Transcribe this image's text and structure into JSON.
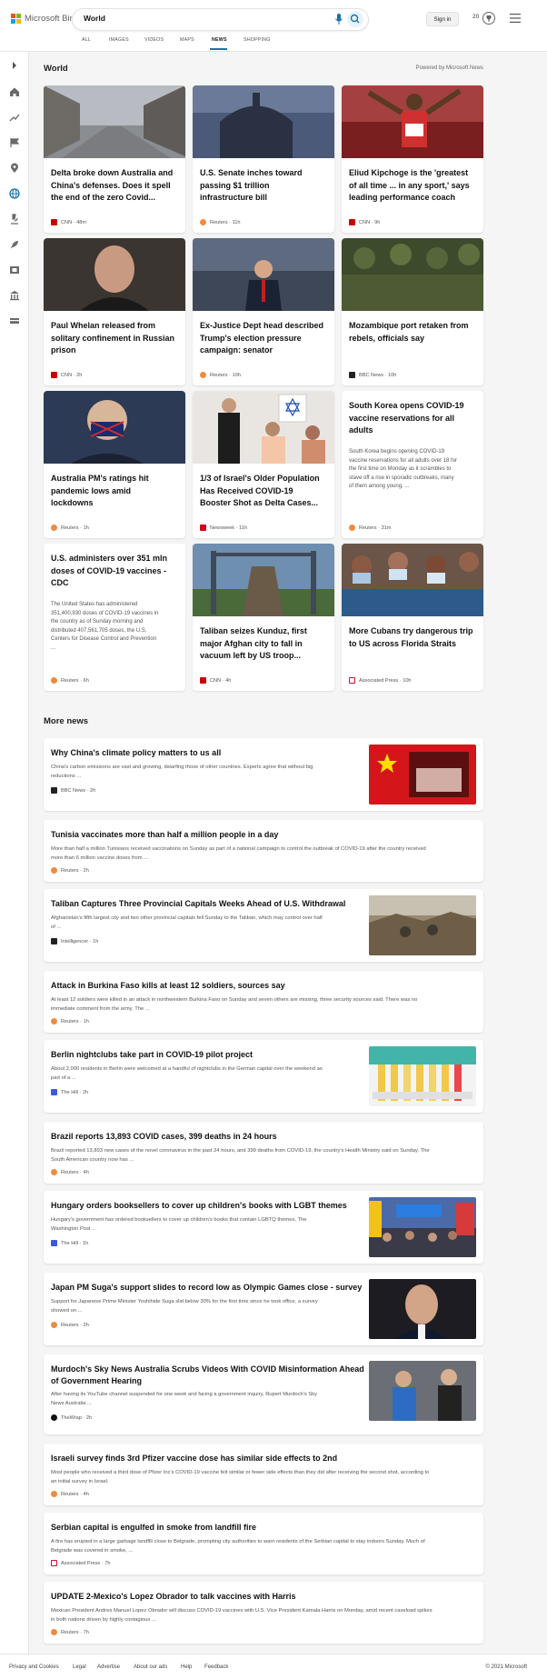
{
  "header": {
    "logo_text": "Microsoft Bing",
    "logo_colors": [
      "#f25022",
      "#7fba00",
      "#00a4ef",
      "#ffb900"
    ],
    "search_value": "World",
    "signin_label": "Sign in",
    "rewards_count": "20",
    "accent": "#1a73a8"
  },
  "tabs": [
    {
      "label": "ALL",
      "active": false
    },
    {
      "label": "IMAGES",
      "active": false
    },
    {
      "label": "VIDEOS",
      "active": false
    },
    {
      "label": "MAPS",
      "active": false
    },
    {
      "label": "NEWS",
      "active": true
    },
    {
      "label": "SHOPPING",
      "active": false
    }
  ],
  "rail": {
    "icons": [
      "chevron-right-icon",
      "home-icon",
      "trending-icon",
      "flag-icon",
      "location-pin-icon",
      "globe-icon",
      "microscope-icon",
      "rocket-icon",
      "film-icon",
      "building-icon",
      "money-icon"
    ],
    "active_color": "#1a73a8"
  },
  "world": {
    "title": "World",
    "powered": "Powered by Microsoft News",
    "cards": [
      {
        "title_lines": [
          "Delta broke down Australia and",
          "China's defenses. Does it spell",
          "the end of the zero Covid..."
        ],
        "source": "CNN",
        "time": "48m",
        "source_icon": "cnn-icon",
        "icon_color": "#cc0000",
        "thumb": "street-icon"
      },
      {
        "title_lines": [
          "U.S. Senate inches toward",
          "passing $1 trillion",
          "infrastructure bill"
        ],
        "source": "Reuters",
        "time": "11h",
        "source_icon": "reuters-icon",
        "icon_color": "#f08b3e",
        "thumb": "capitol-icon"
      },
      {
        "title_lines": [
          "Eliud Kipchoge is the 'greatest",
          "of all time ... in any sport,' says",
          "leading performance coach"
        ],
        "source": "CNN",
        "time": "9h",
        "source_icon": "cnn-icon",
        "icon_color": "#cc0000",
        "thumb": "runner-icon"
      },
      {
        "title_lines": [
          "Paul Whelan released from",
          "solitary confinement in Russian",
          "prison"
        ],
        "source": "CNN",
        "time": "2h",
        "source_icon": "cnn-icon",
        "icon_color": "#cc0000",
        "thumb": "portrait-icon"
      },
      {
        "title_lines": [
          "Ex-Justice Dept head described",
          "Trump's election pressure",
          "campaign: senator"
        ],
        "source": "Reuters",
        "time": "10h",
        "source_icon": "reuters-icon",
        "icon_color": "#f08b3e",
        "thumb": "speaker-icon"
      },
      {
        "title_lines": [
          "Mozambique port retaken from",
          "rebels, officials say"
        ],
        "source": "BBC News",
        "time": "10h",
        "source_icon": "bbc-icon",
        "icon_color": "#222222",
        "thumb": "soldiers-icon"
      },
      {
        "title_lines": [
          "Australia PM's ratings hit",
          "pandemic lows amid",
          "lockdowns"
        ],
        "source": "Reuters",
        "time": "1h",
        "source_icon": "reuters-icon",
        "icon_color": "#f08b3e",
        "thumb": "mask-icon"
      },
      {
        "title_lines": [
          "1/3 of Israel's Older Population",
          "Has Received COVID-19",
          "Booster Shot as Delta Cases..."
        ],
        "source": "Newsweek",
        "time": "11h",
        "source_icon": "newsweek-icon",
        "icon_color": "#d0021b",
        "thumb": "vaccine-icon"
      },
      {
        "title_lines": [
          "South Korea opens COVID-19",
          "vaccine reservations for all",
          "adults"
        ],
        "snippet_lines": [
          "South Korea begins opening COVID-19",
          "vaccine reservations for all adults over 18 for",
          "the first time on Monday as it scrambles to",
          "stave off a rise in sporadic outbreaks, many",
          "of them among young, ..."
        ],
        "source": "Reuters",
        "time": "31m",
        "source_icon": "reuters-icon",
        "icon_color": "#f08b3e"
      },
      {
        "title_lines": [
          "U.S. administers over 351 mln",
          "doses of COVID-19 vaccines -",
          "CDC"
        ],
        "snippet_lines": [
          "The United States has administered",
          "351,400,930 doses of COVID-19 vaccines in",
          "the country as of Sunday morning and",
          "distributed 407,561,705 doses, the U.S.",
          "Centers for Disease Control and Prevention",
          "..."
        ],
        "source": "Reuters",
        "time": "6h",
        "source_icon": "reuters-icon",
        "icon_color": "#f08b3e"
      },
      {
        "title_lines": [
          "Taliban seizes Kunduz, first",
          "major Afghan city to fall in",
          "vacuum left by US troop..."
        ],
        "source": "CNN",
        "time": "4h",
        "source_icon": "cnn-icon",
        "icon_color": "#cc0000",
        "thumb": "statue-icon"
      },
      {
        "title_lines": [
          "More Cubans try dangerous trip",
          "to US across Florida Straits"
        ],
        "source": "Associated Press",
        "time": "10h",
        "source_icon": "ap-icon",
        "icon_color": "#c8102e",
        "thumb": "crowd-icon"
      }
    ]
  },
  "more_news": {
    "title": "More news",
    "items": [
      {
        "title": "Why China's climate policy matters to us all",
        "snippet_lines": [
          "China's carbon emissions are vast and growing, dwarfing those of other countries. Experts agree that without big",
          "reductions ..."
        ],
        "source": "BBC News",
        "time": "2h",
        "icon_color": "#222222",
        "thumb": "china-flag-icon"
      },
      {
        "title": "Tunisia vaccinates more than half a million people in a day",
        "snippet_lines": [
          "More than half a million Tunisians received vaccinations on Sunday as part of a national campaign to control the outbreak of COVID-19 after the country received",
          "more than 6 million vaccine doses from ..."
        ],
        "source": "Reuters",
        "time": "2h",
        "icon_color": "#f08b3e"
      },
      {
        "title": "Taliban Captures Three Provincial Capitals Weeks Ahead of U.S. Withdrawal",
        "snippet_lines": [
          "Afghanistan's fifth largest city and two other provincial capitals fell Sunday to the Taliban, which may control over half",
          "of ..."
        ],
        "source": "Intelligencer",
        "time": "1h",
        "icon_color": "#222222",
        "thumb": "ruins-icon"
      },
      {
        "title": "Attack in Burkina Faso kills at least 12 soldiers, sources say",
        "snippet_lines": [
          "At least 12 soldiers were killed in an attack in northwestern Burkina Faso on Sunday and seven others are missing, three security sources said. There was no",
          "immediate comment from the army. The ..."
        ],
        "source": "Reuters",
        "time": "1h",
        "icon_color": "#f08b3e"
      },
      {
        "title": "Berlin nightclubs take part in COVID-19 pilot project",
        "snippet_lines": [
          "About 2,000 residents in Berlin were welcomed at a handful of nightclubs in the German capital over the weekend as",
          "part of a ..."
        ],
        "source": "The Hill",
        "time": "2h",
        "icon_color": "#3b5bdb",
        "thumb": "test-tubes-icon"
      },
      {
        "title": "Brazil reports 13,893 COVID cases, 399 deaths in 24 hours",
        "snippet_lines": [
          "Brazil reported 13,893 new cases of the novel coronavirus in the past 24 hours, and 399 deaths from COVID-19, the country's Health Ministry said on Sunday. The",
          "South American country now has ..."
        ],
        "source": "Reuters",
        "time": "4h",
        "icon_color": "#f08b3e"
      },
      {
        "title": "Hungary orders booksellers to cover up children's books with LGBT themes",
        "snippet_lines": [
          "Hungary's government has ordered booksellers to cover up children's books that contain LGBTQ themes, The",
          "Washington Post ..."
        ],
        "source": "The Hill",
        "time": "1h",
        "icon_color": "#3b5bdb",
        "thumb": "protest-icon"
      },
      {
        "title": "Japan PM Suga's support slides to record low as Olympic Games close - survey",
        "snippet_lines": [
          "Support for Japanese Prime Minister Yoshihide Suga slid below 30% for the first time since he took office, a survey",
          "showed on ..."
        ],
        "source": "Reuters",
        "time": "2h",
        "icon_color": "#f08b3e",
        "thumb": "man-portrait-icon"
      },
      {
        "title_lines": [
          "Murdoch's Sky News Australia Scrubs Videos With COVID Misinformation Ahead",
          "of Government Hearing"
        ],
        "snippet_lines": [
          "After having its YouTube channel suspended for one week and facing a government inquiry, Rupert Murdoch's Sky",
          "News Australia ..."
        ],
        "source": "TheWrap",
        "time": "2h",
        "icon_color": "#111111",
        "thumb": "two-men-icon"
      },
      {
        "title": "Israeli survey finds 3rd Pfizer vaccine dose has similar side effects to 2nd",
        "snippet_lines": [
          "Most people who received a third dose of Pfizer Inc's COVID-19 vaccine felt similar or fewer side effects than they did after receiving the second shot, according to",
          "an initial survey in Israel."
        ],
        "source": "Reuters",
        "time": "4h",
        "icon_color": "#f08b3e"
      },
      {
        "title": "Serbian capital is engulfed in smoke from landfill fire",
        "snippet_lines": [
          "A fire has erupted in a large garbage landfill close to Belgrade, prompting city authorities to warn residents of the Serbian capital to stay indoors Sunday. Much of",
          "Belgrade was covered in smoke, ..."
        ],
        "source": "Associated Press",
        "time": "7h",
        "icon_color": "#c8102e"
      },
      {
        "title": "UPDATE 2-Mexico's Lopez Obrador to talk vaccines with Harris",
        "snippet_lines": [
          "Mexican President Andres Manuel Lopez Obrador will discuss COVID-19 vaccines with U.S. Vice President Kamala Harris on Monday, amid recent caseload spikes",
          "in both nations driven by highly contagious ..."
        ],
        "source": "Reuters",
        "time": "7h",
        "icon_color": "#f08b3e"
      }
    ]
  },
  "footer": {
    "links": [
      "Privacy and Cookies",
      "Legal",
      "Advertise",
      "About our ads",
      "Help",
      "Feedback"
    ],
    "copyright": "© 2021 Microsoft"
  }
}
